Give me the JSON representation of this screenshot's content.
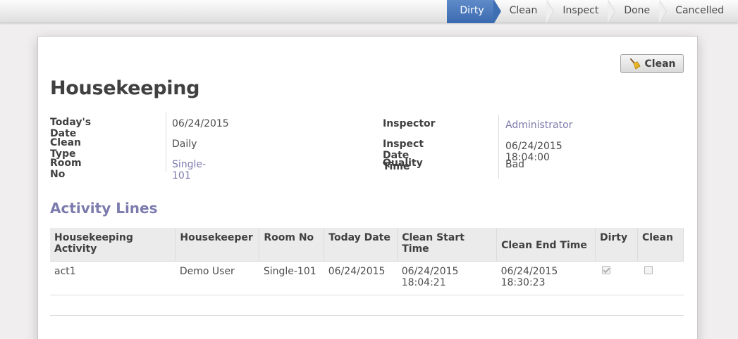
{
  "statusbar": {
    "states": [
      {
        "label": "Dirty",
        "active": true
      },
      {
        "label": "Clean",
        "active": false
      },
      {
        "label": "Inspect",
        "active": false
      },
      {
        "label": "Done",
        "active": false
      },
      {
        "label": "Cancelled",
        "active": false
      }
    ]
  },
  "header": {
    "clean_button_label": "Clean",
    "title": "Housekeeping"
  },
  "fields": {
    "left": [
      {
        "label": "Today's Date",
        "value": "06/24/2015"
      },
      {
        "label": "Clean Type",
        "value": "Daily"
      },
      {
        "label": "Room No",
        "value": "Single-101"
      }
    ],
    "right": [
      {
        "label": "Inspector",
        "value": "Administrator"
      },
      {
        "label": "Inspect Date Time",
        "value": "06/24/2015 18:04:00"
      },
      {
        "label": "Quality",
        "value": "Bad"
      }
    ]
  },
  "activity": {
    "title": "Activity Lines",
    "columns": [
      "Housekeeping Activity",
      "Housekeeper",
      "Room No",
      "Today Date",
      "Clean Start Time",
      "Clean End Time",
      "Dirty",
      "Clean"
    ],
    "rows": [
      {
        "activity": "act1",
        "housekeeper": "Demo User",
        "room": "Single-101",
        "today": "06/24/2015",
        "start_date": "06/24/2015",
        "start_time": "18:04:21",
        "end_date": "06/24/2015",
        "end_time": "18:30:23",
        "dirty": true,
        "clean": false
      }
    ]
  },
  "colors": {
    "accent": "#7c7bad",
    "active_state": "#3f6fb3"
  }
}
